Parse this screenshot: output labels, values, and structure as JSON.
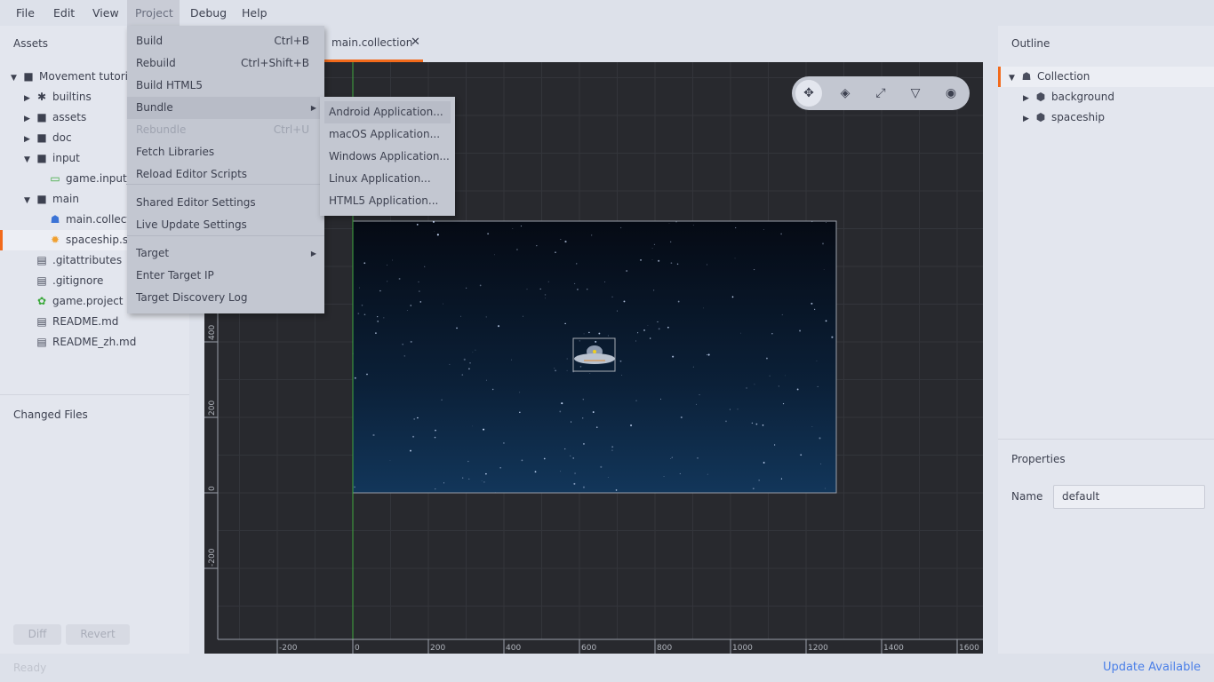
{
  "menubar": {
    "items": [
      "File",
      "Edit",
      "View",
      "Project",
      "Debug",
      "Help"
    ],
    "active": "Project"
  },
  "assets": {
    "title": "Assets",
    "tree": [
      {
        "label": "Movement tutoria",
        "icon": "folder-icon",
        "expanded": true,
        "depth": 0
      },
      {
        "label": "builtins",
        "icon": "puzzle-icon",
        "expanded": false,
        "depth": 1
      },
      {
        "label": "assets",
        "icon": "folder-icon",
        "expanded": false,
        "depth": 1
      },
      {
        "label": "doc",
        "icon": "folder-icon",
        "expanded": false,
        "depth": 1
      },
      {
        "label": "input",
        "icon": "folder-icon",
        "expanded": true,
        "depth": 1
      },
      {
        "label": "game.input_l",
        "icon": "input-binding-icon",
        "depth": 2
      },
      {
        "label": "main",
        "icon": "folder-icon",
        "expanded": true,
        "depth": 1
      },
      {
        "label": "main.collecti",
        "icon": "collection-icon",
        "depth": 2
      },
      {
        "label": "spaceship.scr",
        "icon": "script-gear-icon",
        "depth": 2,
        "selected": true
      },
      {
        "label": ".gitattributes",
        "icon": "file-icon",
        "depth": 1
      },
      {
        "label": ".gitignore",
        "icon": "file-icon",
        "depth": 1
      },
      {
        "label": "game.project",
        "icon": "project-gear-icon",
        "depth": 1
      },
      {
        "label": "README.md",
        "icon": "file-icon",
        "depth": 1
      },
      {
        "label": "README_zh.md",
        "icon": "file-icon",
        "depth": 1
      }
    ]
  },
  "changed_files": {
    "title": "Changed Files",
    "diff": "Diff",
    "revert": "Revert"
  },
  "editor_tab": {
    "label": "main.collection",
    "close": "✕"
  },
  "project_menu": {
    "items": [
      {
        "label": "Build",
        "shortcut": "Ctrl+B"
      },
      {
        "label": "Rebuild",
        "shortcut": "Ctrl+Shift+B"
      },
      {
        "label": "Build HTML5",
        "shortcut": ""
      },
      {
        "label": "Bundle",
        "shortcut": "",
        "submenu": true,
        "highlighted": true
      },
      {
        "label": "Rebundle",
        "shortcut": "Ctrl+U",
        "disabled": true
      },
      {
        "label": "Fetch Libraries",
        "shortcut": ""
      },
      {
        "label": "Reload Editor Scripts",
        "shortcut": ""
      },
      {
        "label": "Shared Editor Settings",
        "shortcut": ""
      },
      {
        "label": "Live Update Settings",
        "shortcut": ""
      },
      {
        "label": "Target",
        "shortcut": "",
        "submenu": true
      },
      {
        "label": "Enter Target IP",
        "shortcut": ""
      },
      {
        "label": "Target Discovery Log",
        "shortcut": ""
      }
    ]
  },
  "bundle_submenu": {
    "items": [
      "Android Application...",
      "macOS Application...",
      "Windows Application...",
      "Linux Application...",
      "HTML5 Application..."
    ],
    "highlighted": 0
  },
  "scene": {
    "x_ticks": [
      "-200",
      "0",
      "200",
      "400",
      "600",
      "800",
      "1000",
      "1200",
      "1400",
      "1600"
    ],
    "y_ticks": [
      "400",
      "200",
      "0",
      "-200"
    ],
    "tools": [
      "move-tool-icon",
      "rotate-tool-icon",
      "scale-tool-icon",
      "perspective-icon",
      "visibility-icon"
    ],
    "active_tool": 0
  },
  "outline": {
    "title": "Outline",
    "items": [
      {
        "label": "Collection",
        "icon": "collection-icon",
        "expanded": true,
        "depth": 0
      },
      {
        "label": "background",
        "icon": "cube-icon",
        "depth": 1
      },
      {
        "label": "spaceship",
        "icon": "cube-icon",
        "depth": 1
      }
    ]
  },
  "properties": {
    "title": "Properties",
    "name_label": "Name",
    "name_value": "default"
  },
  "status": {
    "text": "Ready",
    "update": "Update Available"
  },
  "colors": {
    "accent": "#f26a1b",
    "link": "#4a7fe8",
    "scene_bg": "#28292e"
  }
}
